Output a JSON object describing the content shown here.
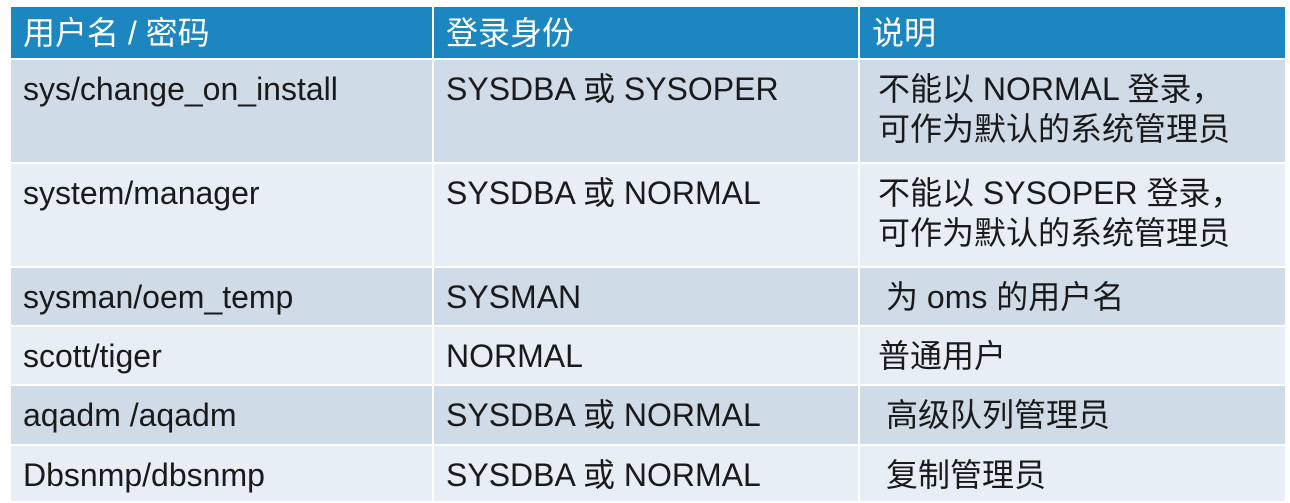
{
  "table": {
    "headers": [
      "用户名 / 密码",
      "登录身份",
      "说明"
    ],
    "rows": [
      {
        "user": "sys/change_on_install",
        "login": "SYSDBA 或 SYSOPER",
        "desc_lines": [
          "不能以 NORMAL 登录，",
          "可作为默认的系统管理员"
        ]
      },
      {
        "user": "system/manager",
        "login": "SYSDBA 或 NORMAL",
        "desc_lines": [
          "不能以 SYSOPER 登录，",
          "可作为默认的系统管理员"
        ]
      },
      {
        "user": "sysman/oem_temp",
        "login": "SYSMAN",
        "desc_lines": [
          "为 oms 的用户名"
        ]
      },
      {
        "user": "scott/tiger",
        "login": "NORMAL",
        "desc_lines": [
          "普通用户"
        ]
      },
      {
        "user": "aqadm /aqadm",
        "login": "SYSDBA 或 NORMAL",
        "desc_lines": [
          "高级队列管理员"
        ]
      },
      {
        "user": "Dbsnmp/dbsnmp",
        "login": "SYSDBA 或 NORMAL",
        "desc_lines": [
          "复制管理员"
        ]
      }
    ]
  },
  "colors": {
    "header_bg": "#1b86bf",
    "row_odd_bg": "#cfdbe6",
    "row_even_bg": "#e8eef5"
  }
}
